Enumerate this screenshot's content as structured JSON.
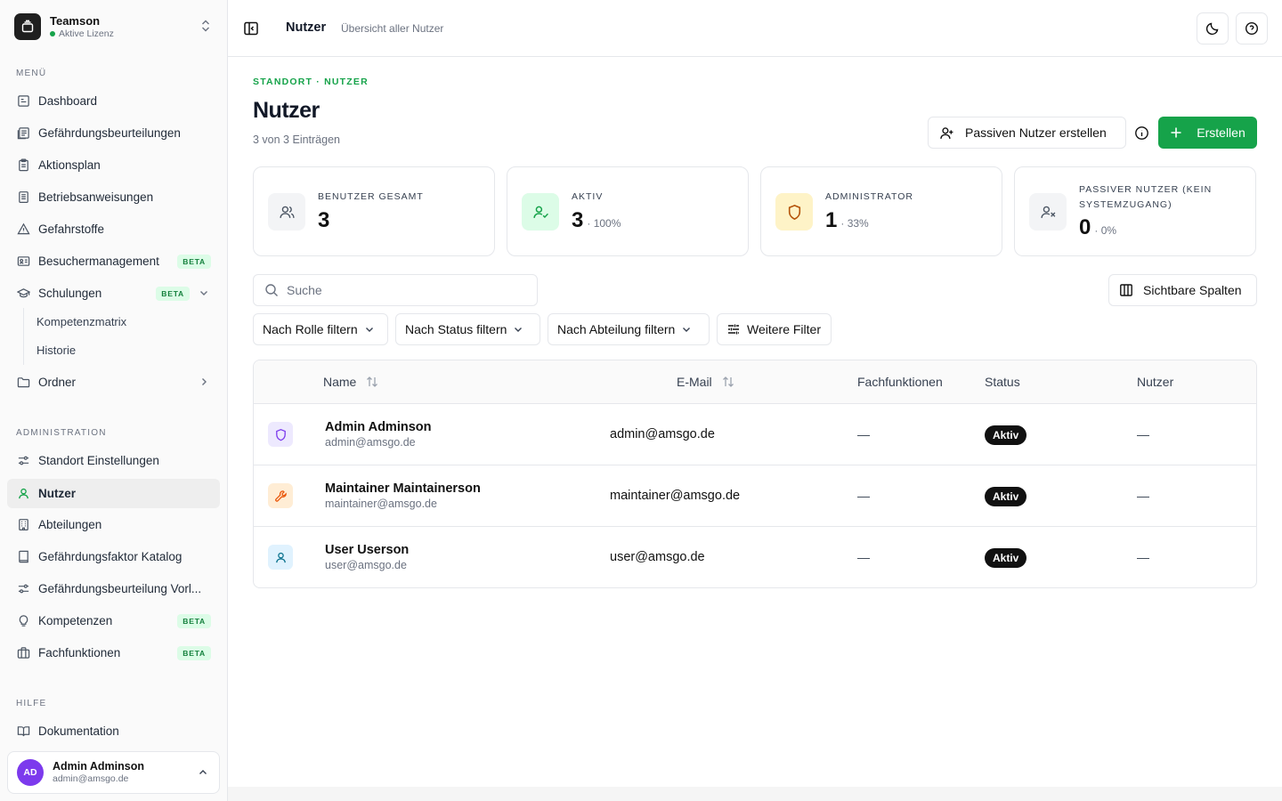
{
  "org": {
    "name": "Teamson",
    "license": "Aktive Lizenz"
  },
  "sidebar": {
    "menu_label": "MENÜ",
    "menu": [
      {
        "label": "Dashboard",
        "icon": "dashboard-icon"
      },
      {
        "label": "Gefährdungsbeurteilungen",
        "icon": "documents-icon"
      },
      {
        "label": "Aktionsplan",
        "icon": "clipboard-icon"
      },
      {
        "label": "Betriebsanweisungen",
        "icon": "file-text-icon"
      },
      {
        "label": "Gefahrstoffe",
        "icon": "warning-icon"
      },
      {
        "label": "Besuchermanagement",
        "icon": "id-card-icon",
        "badge": "BETA"
      },
      {
        "label": "Schulungen",
        "icon": "graduation-cap-icon",
        "badge": "BETA"
      },
      {
        "label": "Ordner",
        "icon": "folder-icon"
      }
    ],
    "sub_items": [
      "Kompetenzmatrix",
      "Historie"
    ],
    "admin_label": "ADMINISTRATION",
    "admin": [
      {
        "label": "Standort Einstellungen",
        "icon": "sliders-icon"
      },
      {
        "label": "Nutzer",
        "icon": "user-icon",
        "active": true
      },
      {
        "label": "Abteilungen",
        "icon": "building-icon"
      },
      {
        "label": "Gefährdungsfaktor Katalog",
        "icon": "book-icon"
      },
      {
        "label": "Gefährdungsbeurteilung Vorl...",
        "icon": "sliders-icon"
      },
      {
        "label": "Kompetenzen",
        "icon": "lightbulb-icon",
        "badge": "BETA"
      },
      {
        "label": "Fachfunktionen",
        "icon": "briefcase-icon",
        "badge": "BETA"
      }
    ],
    "help_label": "HILFE",
    "help": [
      {
        "label": "Dokumentation",
        "icon": "book-open-icon"
      }
    ]
  },
  "current_user": {
    "initials": "AD",
    "name": "Admin Adminson",
    "email": "admin@amsgo.de"
  },
  "header": {
    "title": "Nutzer",
    "subtitle": "Übersicht aller Nutzer"
  },
  "page": {
    "breadcrumb": "STANDORT · NUTZER",
    "title": "Nutzer",
    "count": "3 von 3 Einträgen",
    "passive_button": "Passiven Nutzer erstellen",
    "create_button": "Erstellen"
  },
  "stats": [
    {
      "label": "BENUTZER GESAMT",
      "value": "3",
      "pct": ""
    },
    {
      "label": "AKTIV",
      "value": "3",
      "pct": "· 100%"
    },
    {
      "label": "ADMINISTRATOR",
      "value": "1",
      "pct": "· 33%"
    },
    {
      "label": "PASSIVER NUTZER (KEIN SYSTEMZUGANG)",
      "value": "0",
      "pct": "· 0%"
    }
  ],
  "search": {
    "placeholder": "Suche",
    "value": ""
  },
  "columns_button": "Sichtbare Spalten",
  "filters": {
    "role": "Nach Rolle filtern",
    "status": "Nach Status filtern",
    "department": "Nach Abteilung filtern",
    "more": "Weitere Filter"
  },
  "table": {
    "headers": [
      "Name",
      "E-Mail",
      "Fachfunktionen",
      "Status",
      "Nutzer"
    ],
    "rows": [
      {
        "name": "Admin Adminson",
        "sub": "admin@amsgo.de",
        "email": "admin@amsgo.de",
        "fach": "—",
        "status": "Aktiv",
        "nutzer": "—",
        "role_icon": "shield-icon"
      },
      {
        "name": "Maintainer Maintainerson",
        "sub": "maintainer@amsgo.de",
        "email": "maintainer@amsgo.de",
        "fach": "—",
        "status": "Aktiv",
        "nutzer": "—",
        "role_icon": "wrench-icon"
      },
      {
        "name": "User Userson",
        "sub": "user@amsgo.de",
        "email": "user@amsgo.de",
        "fach": "—",
        "status": "Aktiv",
        "nutzer": "—",
        "role_icon": "user-icon"
      }
    ]
  },
  "colors": {
    "accent": "#16a34a",
    "active_bg": "#eeeeee",
    "admin_role": "#7c3aed",
    "maintainer_role": "#ea580c",
    "user_role": "#0e7490"
  }
}
